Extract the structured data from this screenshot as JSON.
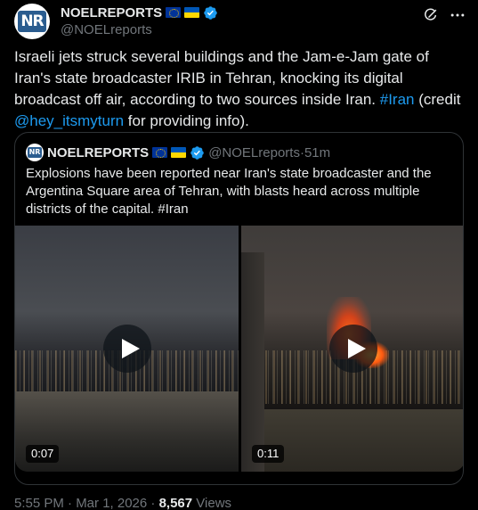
{
  "author": {
    "display_name": "NOELREPORTS",
    "handle": "@NOELreports",
    "avatar_text": "NR",
    "flags": [
      "eu-flag",
      "ukraine-flag"
    ],
    "verified": true
  },
  "tweet": {
    "text_before": "Israeli jets struck several buildings and the Jam-e-Jam gate of Iran's state broadcaster IRIB in Tehran, knocking its digital broadcast off air, according to two sources inside Iran. ",
    "hashtag": "#Iran",
    "text_middle": " (credit ",
    "mention": "@hey_itsmyturn",
    "text_after": " for providing info).",
    "timestamp": "5:55 PM · Mar 1, 2026 · ",
    "views_count": "8,567",
    "views_label": " Views"
  },
  "quoted": {
    "display_name": "NOELREPORTS",
    "handle": "@NOELreports",
    "separator": " · ",
    "age": "51m",
    "avatar_text": "NR",
    "text": "Explosions have been reported near Iran's state broadcaster and the Argentina Square area of Tehran, with blasts heard across multiple districts of the capital. #Iran",
    "videos": [
      {
        "duration": "0:07"
      },
      {
        "duration": "0:11"
      }
    ]
  },
  "colors": {
    "background": "#000000",
    "text": "#e7e9ea",
    "secondary": "#71767b",
    "link": "#1d9bf0",
    "border": "#2f3336"
  },
  "icons": [
    "grok-icon",
    "more-icon",
    "verified-icon",
    "play-icon"
  ]
}
